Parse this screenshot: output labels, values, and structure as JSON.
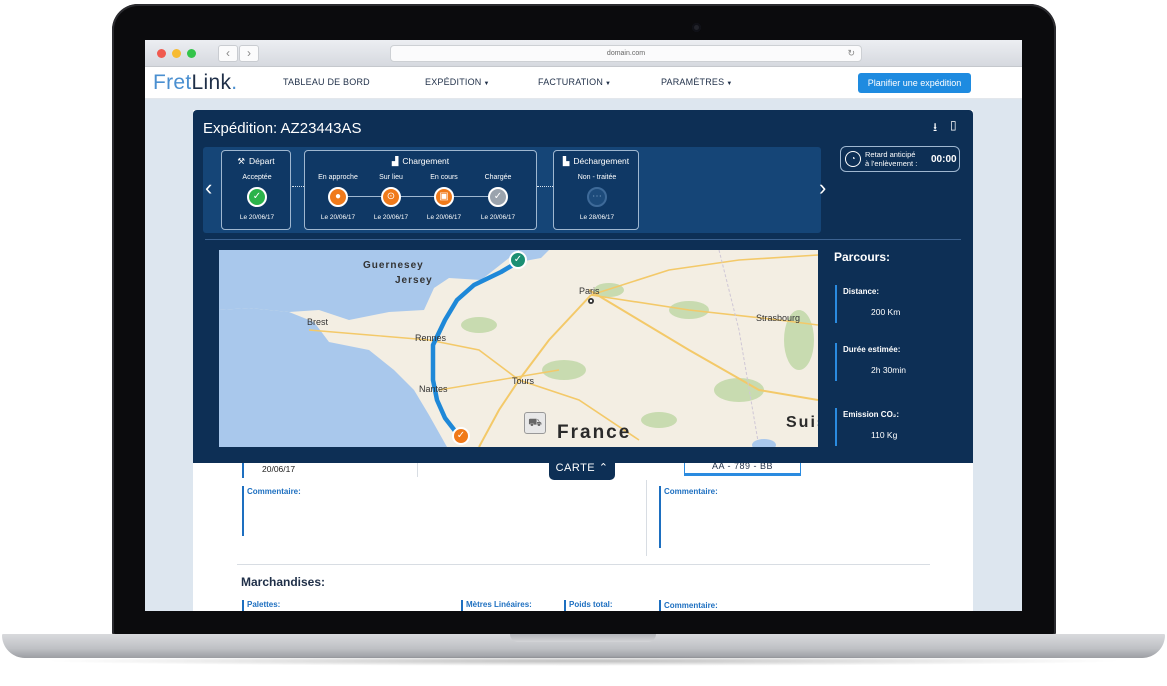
{
  "browser": {
    "url": "domain.com"
  },
  "header": {
    "logo_part1": "Fret",
    "logo_part2": "Link",
    "menu": [
      "TABLEAU DE BORD",
      "EXPÉDITION",
      "FACTURATION",
      "PARAMÈTRES"
    ],
    "cta": "Planifier une expédition"
  },
  "shipment": {
    "title": "Expédition: AZ23443AS",
    "steps": {
      "depart": {
        "label": "Départ",
        "sub": [
          {
            "label": "Acceptée",
            "date": "Le 20/06/17",
            "status": "done",
            "icon": "check-icon"
          }
        ]
      },
      "chargement": {
        "label": "Chargement",
        "sub": [
          {
            "label": "En approche",
            "date": "Le 20/06/17",
            "status": "orange",
            "icon": "location-pin-icon"
          },
          {
            "label": "Sur lieu",
            "date": "Le 20/06/17",
            "status": "orange",
            "icon": "arrival-icon"
          },
          {
            "label": "En cours",
            "date": "Le 20/06/17",
            "status": "orange",
            "icon": "loading-icon"
          },
          {
            "label": "Chargée",
            "date": "Le 20/06/17",
            "status": "grey",
            "icon": "check-icon"
          }
        ]
      },
      "dechargement": {
        "label": "Déchargement",
        "sub": [
          {
            "label": "Non - traitée",
            "date": "Le 28/06/17",
            "status": "pending",
            "icon": "dots-icon"
          }
        ]
      }
    },
    "delay": {
      "label_line1": "Retard anticipé",
      "label_line2": "à l'enlèvement :",
      "value": "00:00"
    },
    "map": {
      "labels": [
        "Guernesey",
        "Jersey",
        "Paris",
        "Brest",
        "Rennes",
        "Strasbourg",
        "Tours",
        "Nantes",
        "France",
        "Suis"
      ]
    },
    "parcours": {
      "title": "Parcours:",
      "items": [
        {
          "label": "Distance:",
          "value": "200 Km"
        },
        {
          "label": "Durée estimée:",
          "value": "2h 30min"
        },
        {
          "label": "Emission CO₂:",
          "value": "110 Kg"
        }
      ]
    },
    "carte_toggle": "CARTE"
  },
  "form": {
    "date": "20/06/17",
    "comment_label": "Commentaire:",
    "plate": "AA - 789 - BB",
    "marchandises": {
      "title": "Marchandises:",
      "fields": [
        "Palettes:",
        "Mètres Linéaires:",
        "Poids total:",
        "Commentaire:"
      ]
    }
  },
  "colors": {
    "primary_dark": "#0d2f55",
    "accent_blue": "#1e8be0",
    "success": "#2bb34a",
    "warning": "#f07a1a"
  }
}
